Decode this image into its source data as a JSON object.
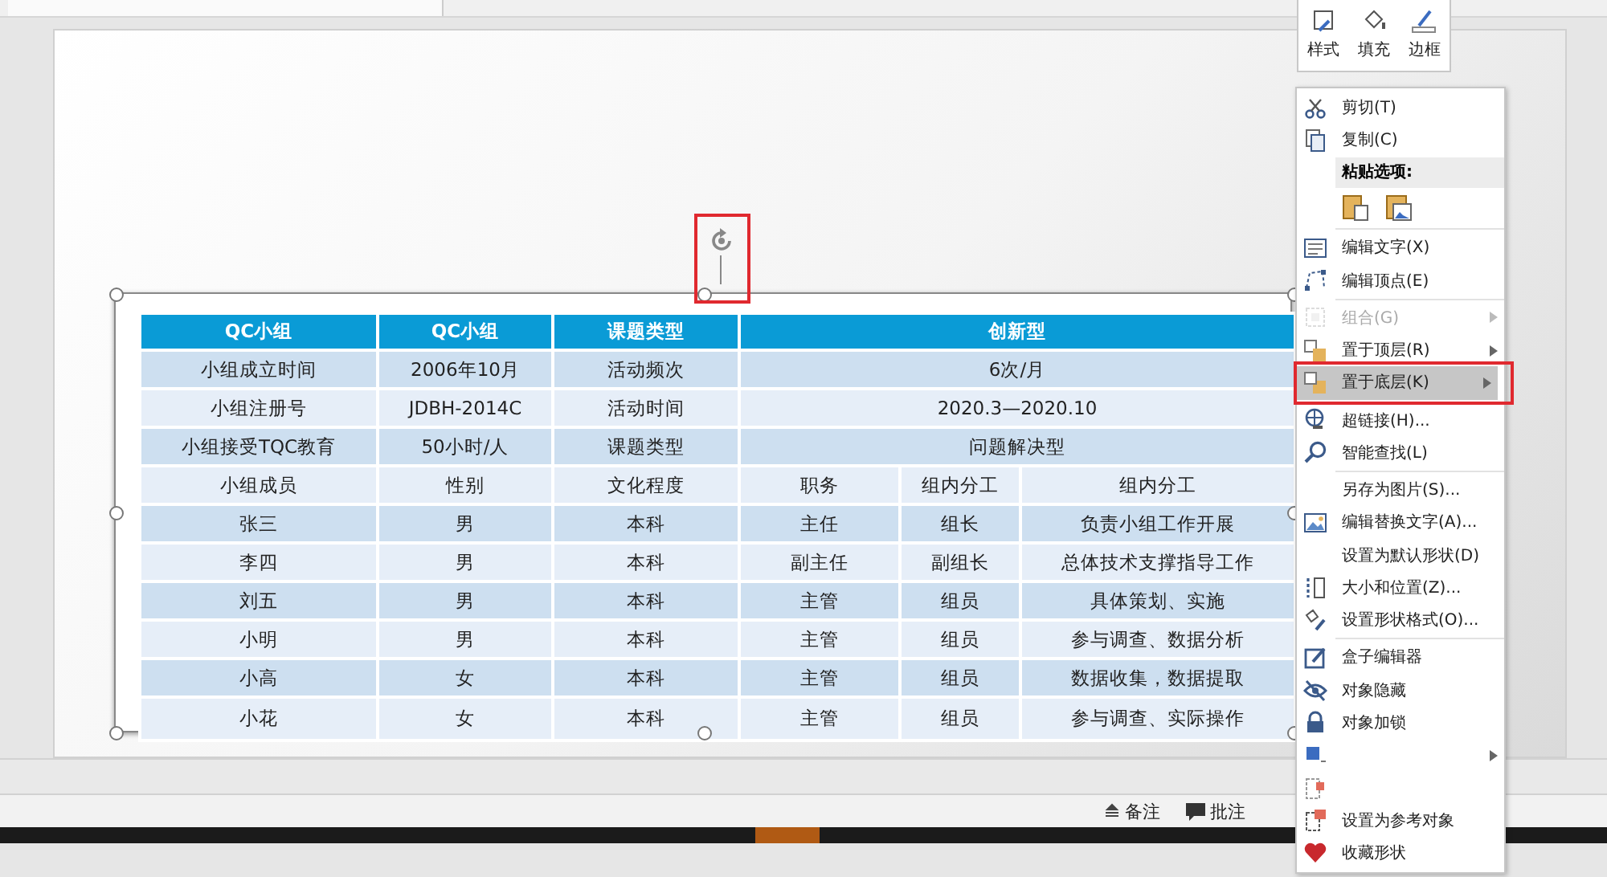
{
  "mini_toolbar": {
    "buttons": [
      {
        "label": "样式"
      },
      {
        "label": "填充"
      },
      {
        "label": "边框"
      }
    ]
  },
  "table": {
    "header": [
      "QC小组",
      "QC小组",
      "课题类型",
      {
        "text": "创新型",
        "colspan": 3
      }
    ],
    "rows": [
      [
        "小组成立时间",
        "2006年10月",
        "活动频次",
        {
          "text": "6次/月",
          "colspan": 3
        }
      ],
      [
        "小组注册号",
        "JDBH-2014C",
        "活动时间",
        {
          "text": "2020.3—2020.10",
          "colspan": 3
        }
      ],
      [
        "小组接受TQC教育",
        "50小时/人",
        "课题类型",
        {
          "text": "问题解决型",
          "colspan": 3
        }
      ],
      [
        "小组成员",
        "性别",
        "文化程度",
        "职务",
        "组内分工",
        "组内分工"
      ],
      [
        "张三",
        "男",
        "本科",
        "主任",
        "组长",
        "负责小组工作开展"
      ],
      [
        "李四",
        "男",
        "本科",
        "副主任",
        "副组长",
        "总体技术支撑指导工作"
      ],
      [
        "刘五",
        "男",
        "本科",
        "主管",
        "组员",
        "具体策划、实施"
      ],
      [
        "小明",
        "男",
        "本科",
        "主管",
        "组员",
        "参与调查、数据分析"
      ],
      [
        "小高",
        "女",
        "本科",
        "主管",
        "组员",
        "数据收集，数据提取"
      ],
      [
        "小花",
        "女",
        "本科",
        "主管",
        "组员",
        "参与调查、实际操作"
      ]
    ]
  },
  "context_menu": {
    "items": [
      {
        "kind": "item",
        "label": "剪切(T)",
        "disabled": false,
        "selected": false,
        "submenu": false
      },
      {
        "kind": "item",
        "label": "复制(C)",
        "disabled": false,
        "selected": false,
        "submenu": false
      },
      {
        "kind": "header",
        "label": "粘贴选项:"
      },
      {
        "kind": "paste"
      },
      {
        "kind": "separator"
      },
      {
        "kind": "item",
        "label": "编辑文字(X)",
        "disabled": false,
        "selected": false,
        "submenu": false
      },
      {
        "kind": "item",
        "label": "编辑顶点(E)",
        "disabled": false,
        "selected": false,
        "submenu": false
      },
      {
        "kind": "separator"
      },
      {
        "kind": "item",
        "label": "组合(G)",
        "disabled": true,
        "selected": false,
        "submenu": true
      },
      {
        "kind": "item",
        "label": "置于顶层(R)",
        "disabled": false,
        "selected": false,
        "submenu": true
      },
      {
        "kind": "item",
        "label": "置于底层(K)",
        "disabled": false,
        "selected": true,
        "submenu": true
      },
      {
        "kind": "separator"
      },
      {
        "kind": "item",
        "label": "超链接(H)...",
        "disabled": false,
        "selected": false,
        "submenu": false
      },
      {
        "kind": "item",
        "label": "智能查找(L)",
        "disabled": false,
        "selected": false,
        "submenu": false
      },
      {
        "kind": "separator"
      },
      {
        "kind": "item",
        "label": "另存为图片(S)...",
        "disabled": false,
        "selected": false,
        "submenu": false
      },
      {
        "kind": "item",
        "label": "编辑替换文字(A)...",
        "disabled": false,
        "selected": false,
        "submenu": false
      },
      {
        "kind": "item",
        "label": "设置为默认形状(D)",
        "disabled": false,
        "selected": false,
        "submenu": false
      },
      {
        "kind": "item",
        "label": "大小和位置(Z)...",
        "disabled": false,
        "selected": false,
        "submenu": false
      },
      {
        "kind": "item",
        "label": "设置形状格式(O)...",
        "disabled": false,
        "selected": false,
        "submenu": false
      },
      {
        "kind": "separator"
      },
      {
        "kind": "item",
        "label": "盒子编辑器",
        "disabled": false,
        "selected": false,
        "submenu": false
      },
      {
        "kind": "item",
        "label": "对象隐藏",
        "disabled": false,
        "selected": false,
        "submenu": false
      },
      {
        "kind": "item",
        "label": "对象加锁",
        "disabled": false,
        "selected": false,
        "submenu": false
      },
      {
        "kind": "item",
        "disabled": false,
        "selected": false,
        "submenu": true
      },
      {
        "kind": "item",
        "disabled": false,
        "selected": false,
        "submenu": false
      },
      {
        "kind": "item",
        "label": "设置为参考对象",
        "disabled": false,
        "selected": false,
        "submenu": false
      },
      {
        "kind": "item",
        "label": "收藏形状",
        "disabled": false,
        "selected": false,
        "submenu": false
      }
    ]
  },
  "status_bar": {
    "buttons": [
      {
        "label": "备注"
      },
      {
        "label": "批注"
      }
    ]
  }
}
